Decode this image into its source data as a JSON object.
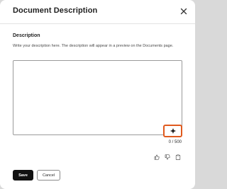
{
  "dialog": {
    "title": "Document Description",
    "close_icon": "close-icon"
  },
  "description": {
    "label": "Description",
    "helper_text": "Write your description here. The description will appear in a preview on the Documents page.",
    "value": "",
    "placeholder": "",
    "counter": "0 / 500",
    "ai_icon": "sparkle-icon",
    "ai_button_highlight_color": "#e05a1e"
  },
  "feedback": {
    "thumbs_up_icon": "thumbs-up-icon",
    "thumbs_down_icon": "thumbs-down-icon",
    "copy_icon": "copy-icon"
  },
  "footer": {
    "save_label": "Save",
    "cancel_label": "Cancel"
  }
}
